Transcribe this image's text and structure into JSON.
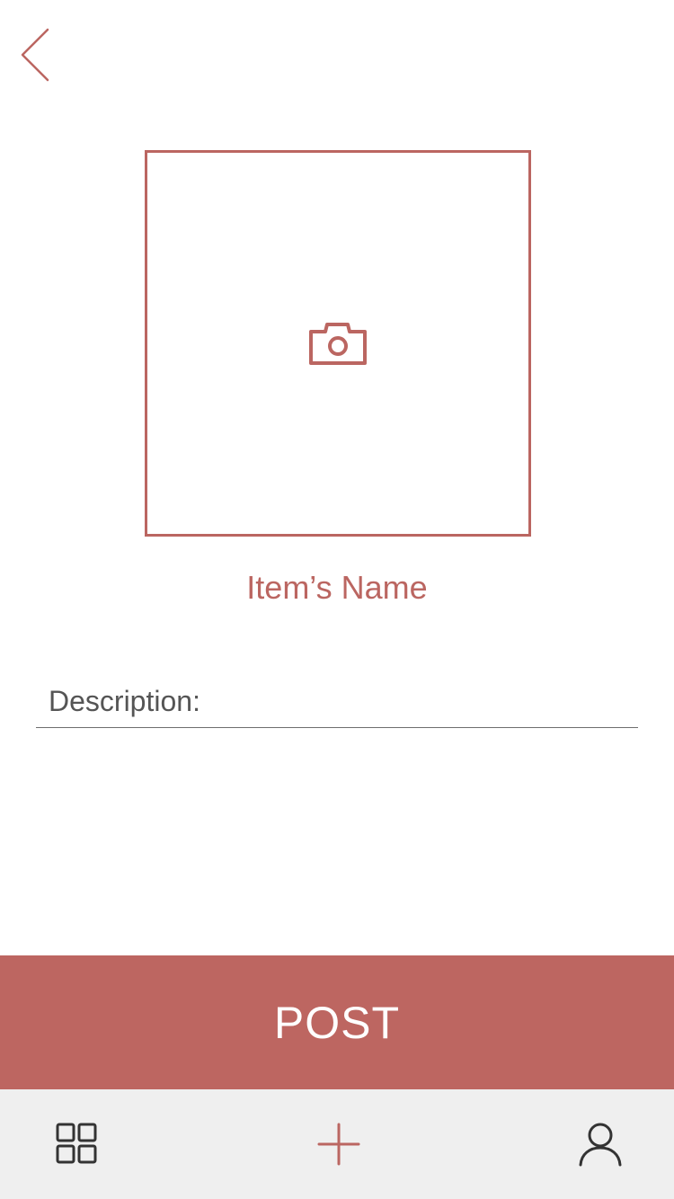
{
  "colors": {
    "accent": "#bb6661",
    "post_background": "#bd6661",
    "tab_bar_background": "#efefef",
    "underline": "#6e6e6e",
    "icon_dark": "#333333"
  },
  "header": {
    "back_icon": "chevron-left-icon"
  },
  "photo": {
    "icon": "camera-icon"
  },
  "item": {
    "name": "Item’s Name"
  },
  "description": {
    "placeholder": "Description:",
    "value": ""
  },
  "actions": {
    "post_label": "POST"
  },
  "tab_bar": {
    "items": [
      {
        "icon": "grid-icon"
      },
      {
        "icon": "plus-icon"
      },
      {
        "icon": "user-icon"
      }
    ]
  }
}
